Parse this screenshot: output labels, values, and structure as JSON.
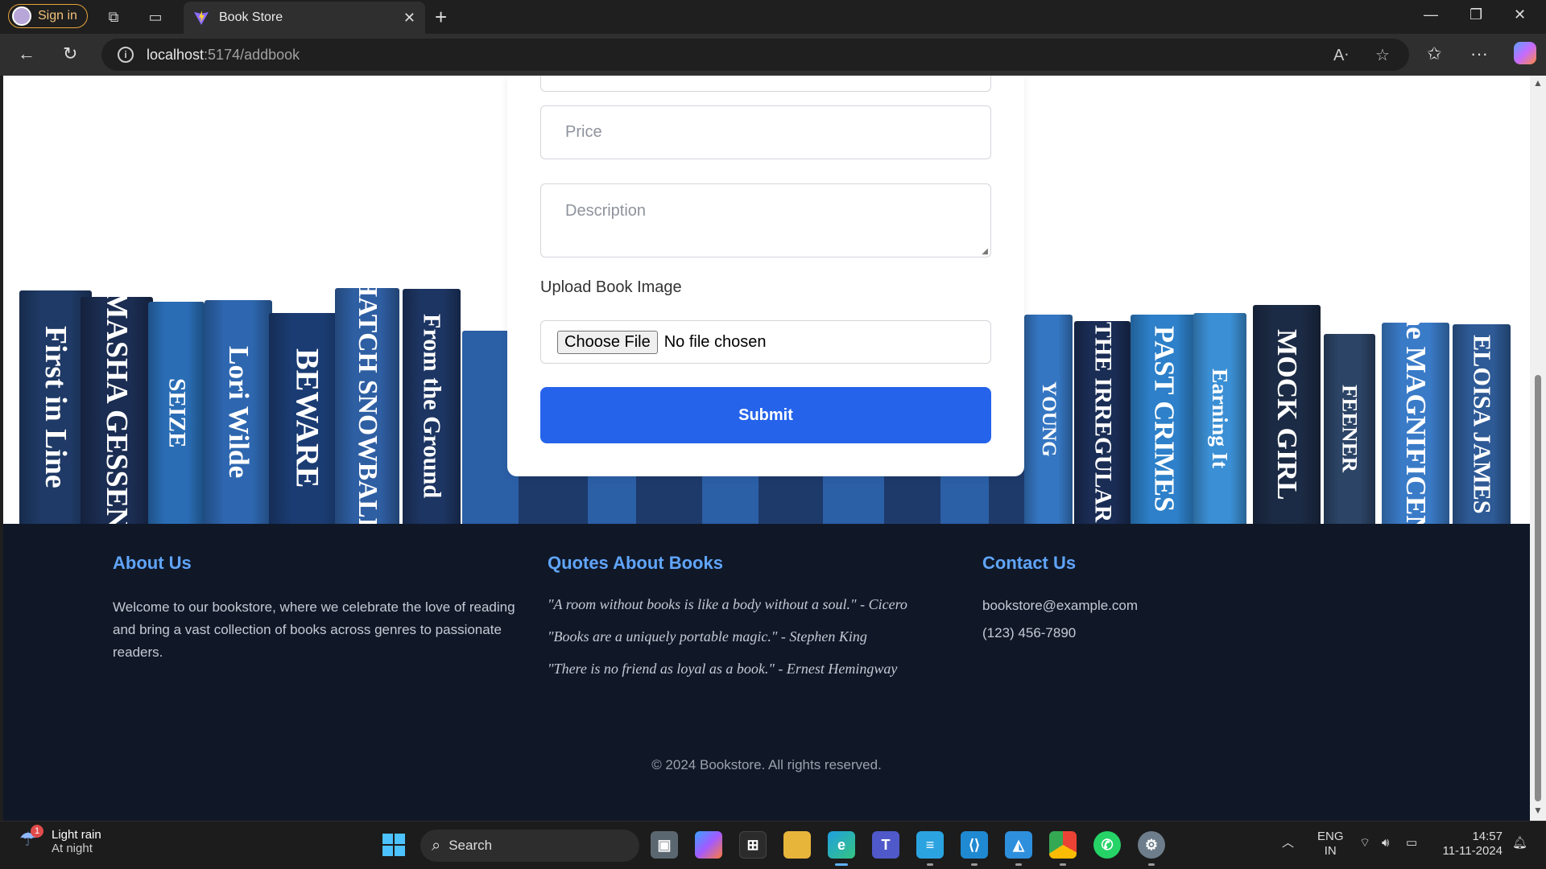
{
  "browser": {
    "signin_label": "Sign in",
    "tab_title": "Book Store",
    "url_host": "localhost",
    "url_path": ":5174/addbook"
  },
  "form": {
    "price_placeholder": "Price",
    "description_placeholder": "Description",
    "upload_label": "Upload Book Image",
    "file_button": "Choose File",
    "file_status": "No file chosen",
    "submit_label": "Submit"
  },
  "books": [
    {
      "title": "First in Line",
      "color": "#1f3a66"
    },
    {
      "title": "MASHA GESSEN",
      "color": "#1b2d52"
    },
    {
      "title": "SEIZE",
      "color": "#2a6db5"
    },
    {
      "title": "Lori Wilde",
      "color": "#2e67b0"
    },
    {
      "title": "BEWARE",
      "color": "#1b3c73"
    },
    {
      "title": "HATCH SNOWBALL",
      "color": "#2f5fa3"
    },
    {
      "title": "From the Ground",
      "color": "#1d3562"
    },
    {
      "title": "YOUNG",
      "color": "#3576c2"
    },
    {
      "title": "THE IRREGULAR",
      "color": "#1a2d55"
    },
    {
      "title": "PAST CRIMES",
      "color": "#2d80c9"
    },
    {
      "title": "Earning It",
      "color": "#3b8fd4"
    },
    {
      "title": "MOCK GIRL",
      "color": "#1c2b45"
    },
    {
      "title": "FEENER",
      "color": "#2c4466"
    },
    {
      "title": "The MAGNIFICENT",
      "color": "#3a7bc8"
    },
    {
      "title": "ELOISA JAMES",
      "color": "#2e5a96"
    }
  ],
  "footer": {
    "about_heading": "About Us",
    "about_text": "Welcome to our bookstore, where we celebrate the love of reading and bring a vast collection of books across genres to passionate readers.",
    "quotes_heading": "Quotes About Books",
    "quotes": [
      "\"A room without books is like a body without a soul.\" - Cicero",
      "\"Books are a uniquely portable magic.\" - Stephen King",
      "\"There is no friend as loyal as a book.\" - Ernest Hemingway"
    ],
    "contact_heading": "Contact Us",
    "email": "bookstore@example.com",
    "phone": "(123) 456-7890",
    "copyright": "© 2024 Bookstore. All rights reserved."
  },
  "taskbar": {
    "weather_title": "Light rain",
    "weather_sub": "At night",
    "weather_badge": "1",
    "search_label": "Search",
    "lang_top": "ENG",
    "lang_bottom": "IN",
    "time": "14:57",
    "date": "11-11-2024"
  }
}
